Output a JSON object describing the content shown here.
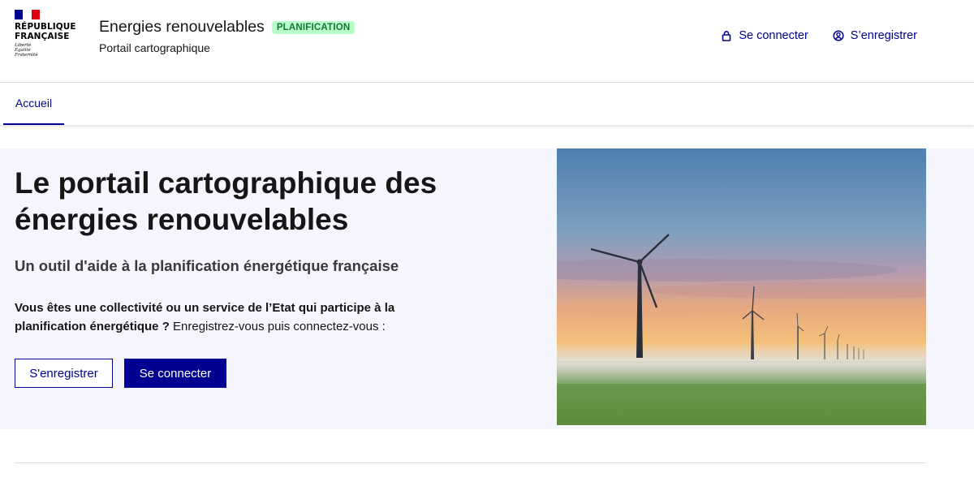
{
  "logo": {
    "title": "RÉPUBLIQUE\nFRANÇAISE",
    "motto": "Liberté\nÉgalité\nFraternité",
    "flag_colors": [
      "#000091",
      "#ffffff",
      "#e1000f"
    ]
  },
  "service": {
    "title": "Energies renouvelables",
    "badge": "PLANIFICATION",
    "tagline": "Portail cartographique"
  },
  "header_links": {
    "login": {
      "label": "Se connecter",
      "icon": "lock-icon"
    },
    "register": {
      "label": "S’enregistrer",
      "icon": "user-circle-icon"
    }
  },
  "nav": {
    "items": [
      {
        "label": "Accueil",
        "active": true
      }
    ]
  },
  "hero": {
    "title": "Le portail cartographique des énergies renouvelables",
    "subtitle": "Un outil d'aide à la planification énergétique française",
    "text_bold": "Vous êtes une collectivité ou un service de l’Etat qui participe à la planification énergétique ?",
    "text_regular": " Enregistrez-vous puis connectez-vous :",
    "register_button": "S'enregistrer",
    "login_button": "Se connecter",
    "image": "wind-turbines-landscape"
  },
  "colors": {
    "primary": "#000091",
    "badge_bg": "#b8fec9",
    "badge_text": "#18753c",
    "hero_bg": "#f5f5fe"
  }
}
